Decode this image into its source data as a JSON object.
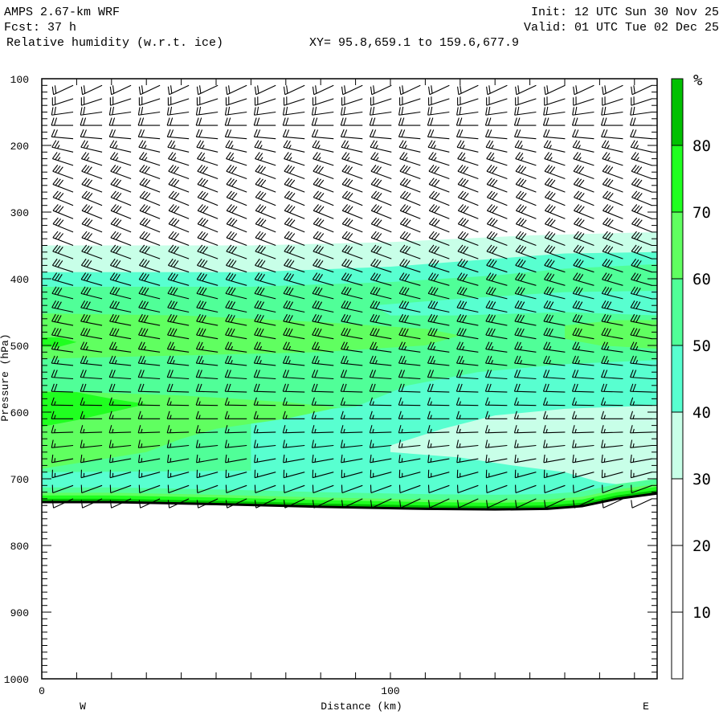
{
  "header": {
    "model": "AMPS 2.67-km WRF",
    "init": "Init: 12 UTC Sun 30 Nov 25",
    "fcst": "Fcst:   37 h",
    "valid": "Valid: 01 UTC Tue 02 Dec 25",
    "field": "Relative humidity (w.r.t. ice)",
    "xy": "XY=  95.8,659.1 to 159.6,677.9"
  },
  "chart_data": {
    "type": "heatmap",
    "title": "Relative humidity (w.r.t. ice)",
    "xlabel": "Distance (km)",
    "ylabel": "Pressure (hPa)",
    "xlim": [
      0,
      176.5
    ],
    "ylim": [
      100,
      1000
    ],
    "x_ticks": [
      "0",
      "100"
    ],
    "x_tick_values": [
      0,
      100
    ],
    "y_ticks": [
      "100",
      "200",
      "300",
      "400",
      "500",
      "600",
      "700",
      "800",
      "900",
      "1000"
    ],
    "y_tick_values": [
      100,
      200,
      300,
      400,
      500,
      600,
      700,
      800,
      900,
      1000
    ],
    "left_end_label": "W",
    "right_end_label": "E",
    "colorbar": {
      "unit": "%",
      "labels": [
        "80",
        "70",
        "60",
        "50",
        "40",
        "30",
        "20",
        "10"
      ],
      "levels": [
        0,
        10,
        20,
        30,
        40,
        50,
        60,
        70,
        80,
        100
      ],
      "colors": [
        "#ffffff",
        "#ffffff",
        "#ffffff",
        "#c8ffe8",
        "#58ffd0",
        "#50ff98",
        "#60ff60",
        "#20ff20",
        "#00c000"
      ]
    },
    "surface_pressure": [
      [
        0,
        735
      ],
      [
        20,
        735
      ],
      [
        50,
        738
      ],
      [
        80,
        742
      ],
      [
        110,
        745
      ],
      [
        130,
        746
      ],
      [
        145,
        745
      ],
      [
        155,
        741
      ],
      [
        165,
        730
      ],
      [
        176.5,
        722
      ]
    ],
    "rh_regions": [
      {
        "band": "30-40",
        "color": "#c8ffe8",
        "points": [
          [
            0,
            350
          ],
          [
            60,
            350
          ],
          [
            100,
            345
          ],
          [
            140,
            335
          ],
          [
            176.5,
            330
          ],
          [
            176.5,
            760
          ],
          [
            0,
            760
          ]
        ]
      },
      {
        "band": "40-50",
        "color": "#58ffd0",
        "points": [
          [
            0,
            390
          ],
          [
            60,
            390
          ],
          [
            100,
            382
          ],
          [
            130,
            370
          ],
          [
            150,
            362
          ],
          [
            176.5,
            360
          ],
          [
            176.5,
            760
          ],
          [
            0,
            760
          ]
        ]
      },
      {
        "band": "50-60",
        "color": "#50ff98",
        "points": [
          [
            0,
            412
          ],
          [
            60,
            412
          ],
          [
            100,
            405
          ],
          [
            130,
            395
          ],
          [
            150,
            385
          ],
          [
            176.5,
            378
          ],
          [
            176.5,
            760
          ],
          [
            0,
            760
          ]
        ]
      },
      {
        "band": "40-50",
        "color": "#58ffd0",
        "points": [
          [
            60,
            605
          ],
          [
            90,
            592
          ],
          [
            105,
            560
          ],
          [
            125,
            540
          ],
          [
            150,
            528
          ],
          [
            176.5,
            522
          ],
          [
            176.5,
            760
          ],
          [
            60,
            760
          ]
        ]
      },
      {
        "band": "40-50",
        "color": "#58ffd0",
        "points": [
          [
            0,
            690
          ],
          [
            60,
            688
          ],
          [
            60,
            760
          ],
          [
            0,
            760
          ]
        ]
      },
      {
        "band": "40-50",
        "color": "#58ffd0",
        "points": [
          [
            95,
            440
          ],
          [
            120,
            430
          ],
          [
            150,
            420
          ],
          [
            176.5,
            418
          ],
          [
            176.5,
            455
          ],
          [
            150,
            450
          ],
          [
            120,
            455
          ],
          [
            100,
            455
          ]
        ]
      },
      {
        "band": "30-40",
        "color": "#c8ffe8",
        "points": [
          [
            100,
            650
          ],
          [
            115,
            625
          ],
          [
            130,
            605
          ],
          [
            150,
            595
          ],
          [
            176.5,
            590
          ],
          [
            176.5,
            715
          ],
          [
            160,
            705
          ],
          [
            150,
            690
          ],
          [
            135,
            680
          ],
          [
            120,
            668
          ],
          [
            100,
            660
          ]
        ]
      },
      {
        "band": "60-70",
        "color": "#60ff60",
        "points": [
          [
            0,
            452
          ],
          [
            40,
            455
          ],
          [
            80,
            465
          ],
          [
            110,
            475
          ],
          [
            120,
            485
          ],
          [
            110,
            500
          ],
          [
            80,
            510
          ],
          [
            40,
            515
          ],
          [
            0,
            520
          ]
        ]
      },
      {
        "band": "60-70",
        "color": "#60ff60",
        "points": [
          [
            150,
            470
          ],
          [
            165,
            462
          ],
          [
            176.5,
            462
          ],
          [
            176.5,
            505
          ],
          [
            160,
            500
          ],
          [
            150,
            490
          ]
        ]
      },
      {
        "band": "60-70",
        "color": "#60ff60",
        "points": [
          [
            0,
            568
          ],
          [
            40,
            575
          ],
          [
            70,
            585
          ],
          [
            85,
            593
          ],
          [
            70,
            610
          ],
          [
            50,
            625
          ],
          [
            40,
            640
          ],
          [
            30,
            660
          ],
          [
            0,
            685
          ]
        ]
      },
      {
        "band": "70-80",
        "color": "#20ff20",
        "points": [
          [
            0,
            570
          ],
          [
            10,
            570
          ],
          [
            20,
            580
          ],
          [
            30,
            588
          ],
          [
            20,
            600
          ],
          [
            10,
            612
          ],
          [
            0,
            622
          ]
        ]
      },
      {
        "band": "70-80",
        "color": "#20ff20",
        "points": [
          [
            0,
            488
          ],
          [
            5,
            488
          ],
          [
            10,
            495
          ],
          [
            5,
            502
          ],
          [
            0,
            502
          ]
        ]
      }
    ],
    "surface_layers": [
      {
        "band": "50-60",
        "color": "#50ff98",
        "depth_hPa": 22
      },
      {
        "band": "60-70",
        "color": "#60ff60",
        "depth_hPa": 14
      },
      {
        "band": "70-80",
        "color": "#20ff20",
        "depth_hPa": 10
      },
      {
        "band": "80+",
        "color": "#00c000",
        "depth_hPa": 5
      }
    ],
    "wind_columns_km": [
      9,
      17.3,
      25.6,
      33.9,
      42.2,
      50.5,
      58.8,
      67.1,
      75.4,
      83.7,
      92,
      100.3,
      108.6,
      116.9,
      125.2,
      133.5,
      141.8,
      150.1,
      158.4,
      166.7,
      175
    ],
    "wind_profile": [
      {
        "p": 110,
        "dir": 245,
        "kt": 20
      },
      {
        "p": 130,
        "dir": 252,
        "kt": 20
      },
      {
        "p": 150,
        "dir": 262,
        "kt": 20
      },
      {
        "p": 170,
        "dir": 270,
        "kt": 20
      },
      {
        "p": 190,
        "dir": 275,
        "kt": 20
      },
      {
        "p": 210,
        "dir": 283,
        "kt": 25
      },
      {
        "p": 230,
        "dir": 288,
        "kt": 25
      },
      {
        "p": 250,
        "dir": 290,
        "kt": 30
      },
      {
        "p": 270,
        "dir": 291,
        "kt": 30
      },
      {
        "p": 290,
        "dir": 292,
        "kt": 30
      },
      {
        "p": 310,
        "dir": 292,
        "kt": 30
      },
      {
        "p": 330,
        "dir": 292,
        "kt": 30
      },
      {
        "p": 350,
        "dir": 291,
        "kt": 30
      },
      {
        "p": 370,
        "dir": 290,
        "kt": 30
      },
      {
        "p": 390,
        "dir": 288,
        "kt": 30
      },
      {
        "p": 410,
        "dir": 286,
        "kt": 30
      },
      {
        "p": 430,
        "dir": 284,
        "kt": 30
      },
      {
        "p": 450,
        "dir": 282,
        "kt": 30
      },
      {
        "p": 470,
        "dir": 281,
        "kt": 30
      },
      {
        "p": 490,
        "dir": 280,
        "kt": 30
      },
      {
        "p": 510,
        "dir": 278,
        "kt": 25
      },
      {
        "p": 530,
        "dir": 276,
        "kt": 25
      },
      {
        "p": 550,
        "dir": 274,
        "kt": 20
      },
      {
        "p": 570,
        "dir": 272,
        "kt": 20
      },
      {
        "p": 590,
        "dir": 271,
        "kt": 15
      },
      {
        "p": 610,
        "dir": 270,
        "kt": 15
      },
      {
        "p": 630,
        "dir": 268,
        "kt": 15
      },
      {
        "p": 650,
        "dir": 264,
        "kt": 15
      },
      {
        "p": 670,
        "dir": 260,
        "kt": 15
      },
      {
        "p": 690,
        "dir": 255,
        "kt": 15
      },
      {
        "p": 710,
        "dir": 250,
        "kt": 10
      },
      {
        "p": 730,
        "dir": 245,
        "kt": 10
      }
    ]
  }
}
